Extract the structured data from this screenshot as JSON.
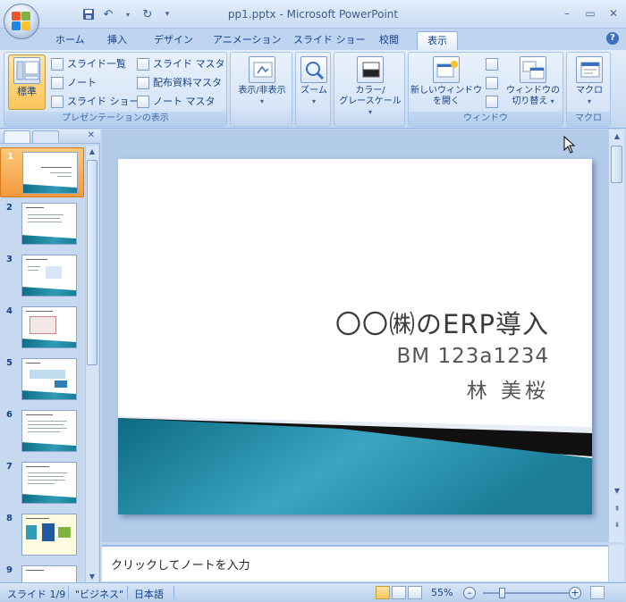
{
  "window": {
    "title": "pp1.pptx - Microsoft PowerPoint",
    "controls": [
      "_",
      "▭",
      "✕"
    ]
  },
  "qat": [
    "save",
    "undo",
    "redo",
    "customize"
  ],
  "tabs": [
    {
      "label": "ホーム"
    },
    {
      "label": "挿入"
    },
    {
      "label": "デザイン"
    },
    {
      "label": "アニメーション"
    },
    {
      "label": "スライド ショー"
    },
    {
      "label": "校閲"
    },
    {
      "label": "表示"
    }
  ],
  "active_tab": "表示",
  "ribbon": {
    "presentation_views": {
      "label": "プレゼンテーションの表示",
      "normal": "標準",
      "slide_sorter": "スライド一覧",
      "notes_page": "ノート",
      "slide_show": "スライド ショー",
      "slide_master": "スライド マスタ",
      "handout_master": "配布資料マスタ",
      "notes_master": "ノート マスタ"
    },
    "show_hide": {
      "label": "表示/非表示"
    },
    "zoom": {
      "label": "ズーム"
    },
    "color_grayscale": {
      "line1": "カラー/",
      "line2": "グレースケール"
    },
    "window": {
      "label": "ウィンドウ",
      "new_window_line1": "新しいウィンドウ",
      "new_window_line2": "を開く",
      "switch_line1": "ウィンドウの",
      "switch_line2": "切り替え"
    },
    "macro": {
      "label": "マクロ",
      "button": "マクロ"
    }
  },
  "thumbnails": [
    {
      "num": "1"
    },
    {
      "num": "2"
    },
    {
      "num": "3"
    },
    {
      "num": "4"
    },
    {
      "num": "5"
    },
    {
      "num": "6"
    },
    {
      "num": "7"
    },
    {
      "num": "8"
    },
    {
      "num": "9"
    }
  ],
  "slide": {
    "title": "〇〇㈱のERP導入",
    "subtitle_line1": "BM 123a1234",
    "subtitle_line2": "林 美桜"
  },
  "notes": {
    "placeholder": "クリックしてノートを入力"
  },
  "status": {
    "slide": "スライド 1/9",
    "theme": "\"ビジネス\"",
    "language": "日本語",
    "zoom": "55%"
  },
  "colors": {
    "accent": "#15428b",
    "selected": "#f59a3d",
    "slide_band": "#1a7d97"
  }
}
